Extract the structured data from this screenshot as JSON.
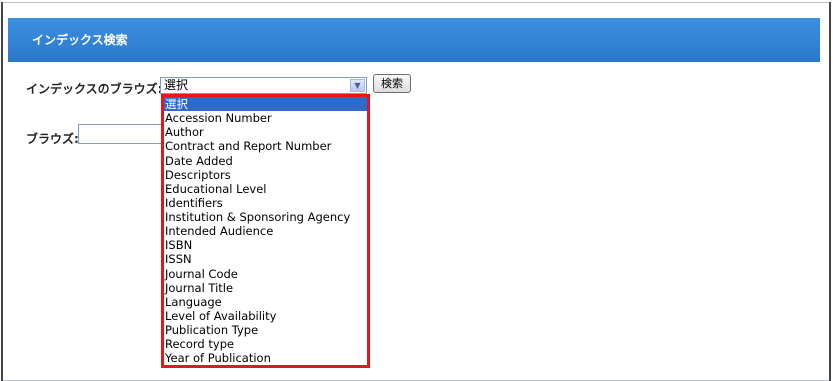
{
  "header": {
    "title": "インデックス検索"
  },
  "index_browse": {
    "label": "インデックスのブラウズ:",
    "selected_value": "選択",
    "search_button": "検索",
    "options": [
      "選択",
      "Accession Number",
      "Author",
      "Contract and Report Number",
      "Date Added",
      "Descriptors",
      "Educational Level",
      "Identifiers",
      "Institution & Sponsoring Agency",
      "Intended Audience",
      "ISBN",
      "ISSN",
      "Journal Code",
      "Journal Title",
      "Language",
      "Level of Availability",
      "Publication Type",
      "Record type",
      "Year of Publication"
    ],
    "highlight_color": "#e8141e",
    "selected_option_color": "#3169c6"
  },
  "browse": {
    "label": "ブラウズ:",
    "value": ""
  }
}
